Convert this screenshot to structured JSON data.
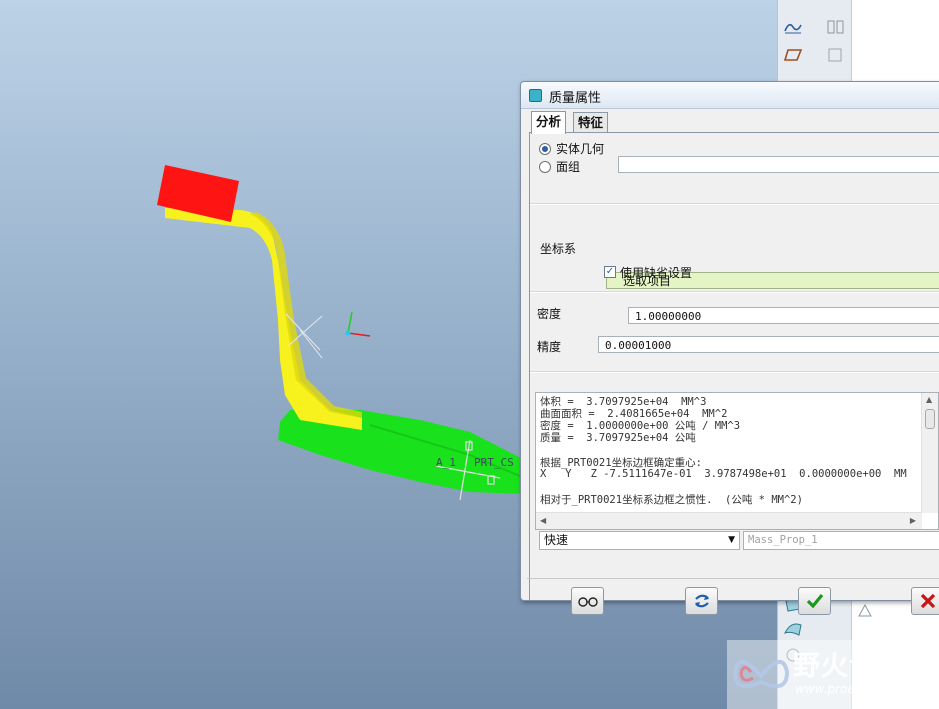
{
  "viewport": {
    "datum_labels": {
      "axis": "A_1",
      "csys": "PRT_CS"
    }
  },
  "dialog": {
    "title": "质量属性",
    "tabs": [
      {
        "label": "分析"
      },
      {
        "label": "特征"
      }
    ],
    "geometry_options": {
      "solid": "实体几何",
      "quilt": "面组",
      "selected": "solid"
    },
    "quilt_input": "",
    "csys_label": "坐标系",
    "csys_select_text": "选取项目",
    "use_default_label": "使用缺省设置",
    "use_default_checked": true,
    "density_label": "密度",
    "density_value": "1.00000000",
    "accuracy_label": "精度",
    "accuracy_value": "0.00001000",
    "results_lines": [
      "体积 =  3.7097925e+04  MM^3",
      "曲面面积 =  2.4081665e+04  MM^2",
      "密度 =  1.0000000e+00 公吨 / MM^3",
      "质量 =  3.7097925e+04 公吨",
      "",
      "根据_PRT0021坐标边框确定重心:",
      "X   Y   Z -7.5111647e-01  3.9787498e+01  0.0000000e+00  MM",
      "",
      "相对于_PRT0021坐标系边框之惯性.  (公吨 * MM^2)"
    ],
    "mode_value": "快速",
    "feature_name_placeholder": "Mass_Prop_1",
    "colors": {
      "select_bg": "#e4f4c4",
      "ok": "#1a9a1a",
      "cancel": "#c81414"
    }
  },
  "watermark": {
    "text": "野火论坛",
    "url": "www.proewildfire.cn"
  }
}
